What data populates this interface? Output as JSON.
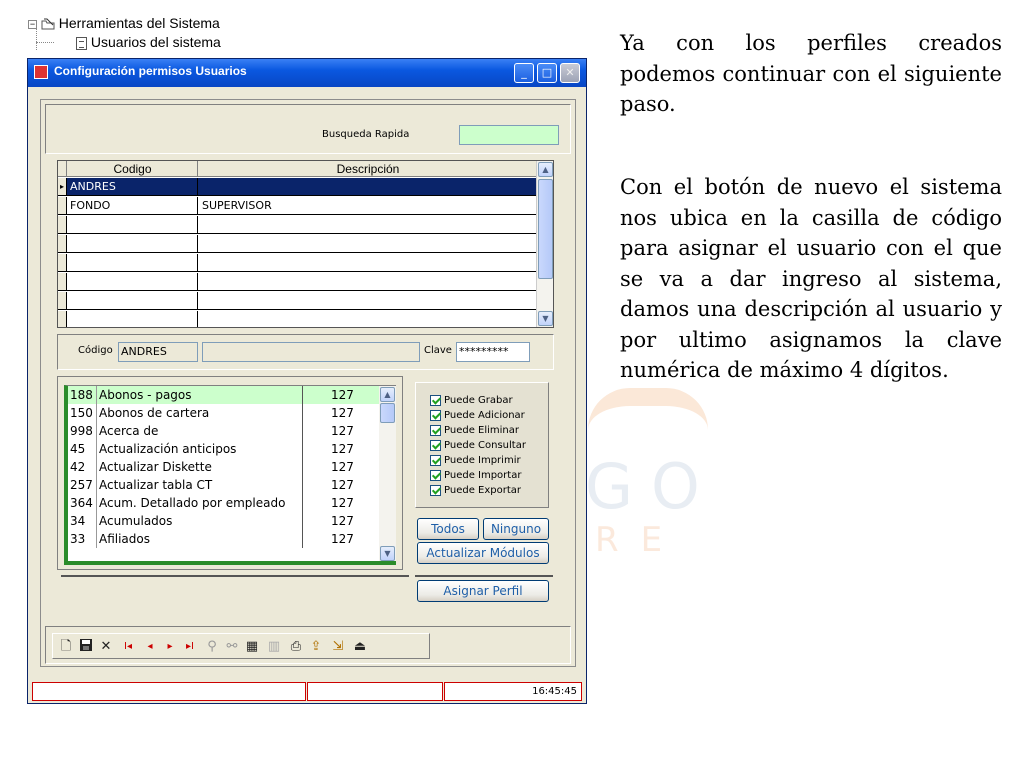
{
  "tree": {
    "parent_label": "Herramientas del Sistema",
    "child_label": "Usuarios del sistema",
    "expand_glyph": "−"
  },
  "window": {
    "title": "Configuración permisos Usuarios",
    "controls": {
      "minimize": "_",
      "maximize": "□",
      "close": "✕"
    }
  },
  "search": {
    "label": "Busqueda Rapida",
    "value": ""
  },
  "users_grid": {
    "columns": [
      "Codigo",
      "Descripción"
    ],
    "rows": [
      {
        "codigo": "ANDRES",
        "descripcion": "",
        "selected": true
      },
      {
        "codigo": "FONDO",
        "descripcion": "SUPERVISOR",
        "selected": false
      },
      {
        "codigo": "",
        "descripcion": "",
        "selected": false
      },
      {
        "codigo": "",
        "descripcion": "",
        "selected": false
      },
      {
        "codigo": "",
        "descripcion": "",
        "selected": false
      },
      {
        "codigo": "",
        "descripcion": "",
        "selected": false
      },
      {
        "codigo": "",
        "descripcion": "",
        "selected": false
      },
      {
        "codigo": "",
        "descripcion": "",
        "selected": false
      }
    ]
  },
  "user_form": {
    "codigo_label": "Código",
    "codigo_value": "ANDRES",
    "descripcion_value": "",
    "clave_label": "Clave",
    "clave_value": "*********"
  },
  "modules": [
    {
      "id": "188",
      "name": "Abonos - pagos",
      "value": "127",
      "highlight": true
    },
    {
      "id": "150",
      "name": "Abonos de cartera",
      "value": "127",
      "highlight": false
    },
    {
      "id": "998",
      "name": "Acerca de",
      "value": "127",
      "highlight": false
    },
    {
      "id": "45",
      "name": "Actualización anticipos",
      "value": "127",
      "highlight": false
    },
    {
      "id": "42",
      "name": "Actualizar Diskette",
      "value": "127",
      "highlight": false
    },
    {
      "id": "257",
      "name": "Actualizar tabla CT",
      "value": "127",
      "highlight": false
    },
    {
      "id": "364",
      "name": "Acum. Detallado por empleado",
      "value": "127",
      "highlight": false
    },
    {
      "id": "34",
      "name": "Acumulados",
      "value": "127",
      "highlight": false
    },
    {
      "id": "33",
      "name": "Afiliados",
      "value": "127",
      "highlight": false
    }
  ],
  "permissions": [
    {
      "label": "Puede Grabar",
      "checked": true
    },
    {
      "label": "Puede Adicionar",
      "checked": true
    },
    {
      "label": "Puede Eliminar",
      "checked": true
    },
    {
      "label": "Puede Consultar",
      "checked": true
    },
    {
      "label": "Puede Imprimir",
      "checked": true
    },
    {
      "label": "Puede Importar",
      "checked": true
    },
    {
      "label": "Puede Exportar",
      "checked": true
    }
  ],
  "buttons": {
    "todos": "Todos",
    "ninguno": "Ninguno",
    "actualizar": "Actualizar Módulos",
    "asignar": "Asignar Perfil"
  },
  "toolbar_glyphs": {
    "new": "🗋",
    "save": "▪",
    "delete": "✕",
    "first": "I◂",
    "prev": "◂",
    "next": "▸",
    "last": "▸I",
    "find": "⚲",
    "link": "⚯",
    "grid": "▦",
    "chart": "▥",
    "print": "⎙",
    "export1": "⇪",
    "export2": "⇲",
    "exit": "⏏"
  },
  "status": {
    "clock": "16:45:45"
  },
  "side_text": {
    "p1": "Ya con los perfiles creados podemos continuar con el siguiente paso.",
    "p2": "Con el botón de nuevo el sistema nos ubica en la casilla de código para asignar el usuario con el que se va a dar ingreso al sistema, damos una descripción al usuario y por ultimo asignamos la clave numérica de máximo 4 dígitos."
  },
  "watermark": {
    "line1": "GO",
    "line2": "RE"
  },
  "colors": {
    "titlebar": "#0a58e0",
    "selection": "#0a246a",
    "highlight_green": "#ccffcc",
    "list_border_green": "#2a8c2a",
    "button_text": "#1f5fa8",
    "status_border": "#cc0000"
  }
}
